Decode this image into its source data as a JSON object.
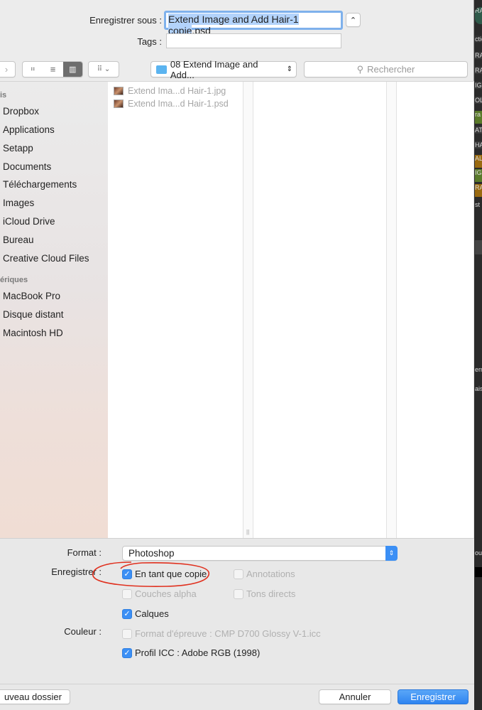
{
  "header": {
    "save_as_label": "Enregistrer sous :",
    "filename": "Extend Image and Add Hair-1 copie",
    "extension": ".psd",
    "tags_label": "Tags :",
    "tags_value": ""
  },
  "toolbar": {
    "location": "08 Extend Image and Add...",
    "search_placeholder": "Rechercher"
  },
  "sidebar": {
    "favorites_header": "is",
    "favorites": [
      "Dropbox",
      "Applications",
      "Setapp",
      "Documents",
      "Téléchargements",
      "Images",
      "iCloud Drive",
      "Bureau",
      "Creative Cloud Files"
    ],
    "devices_header": "ériques",
    "devices": [
      "MacBook Pro",
      "Disque distant",
      "Macintosh HD"
    ]
  },
  "files": [
    "Extend Ima...d Hair-1.jpg",
    "Extend Ima...d Hair-1.psd"
  ],
  "options": {
    "format_label": "Format :",
    "format_value": "Photoshop",
    "save_label": "Enregistrer :",
    "color_label": "Couleur :",
    "checkboxes": [
      {
        "label": "En tant que copie",
        "checked": true,
        "enabled": true
      },
      {
        "label": "Annotations",
        "checked": false,
        "enabled": false
      },
      {
        "label": "Couches alpha",
        "checked": false,
        "enabled": false
      },
      {
        "label": "Tons directs",
        "checked": false,
        "enabled": false
      },
      {
        "label": "Calques",
        "checked": true,
        "enabled": true
      },
      {
        "label": "Format d'épreuve : CMP D700 Glossy V-1.icc",
        "checked": false,
        "enabled": false
      },
      {
        "label": "Profil ICC : Adobe RGB (1998)",
        "checked": true,
        "enabled": true
      }
    ]
  },
  "footer": {
    "new_folder": "uveau dossier",
    "cancel": "Annuler",
    "save": "Enregistrer"
  },
  "colors": {
    "accent": "#3b8ff5",
    "annotation": "#e0301e"
  },
  "background_app_fragments": [
    "RA",
    "ctio",
    "RA",
    "RA",
    "IG",
    "OL",
    "ra",
    "AT",
    "HA",
    "AL",
    "IG",
    "RA",
    "st",
    "ern",
    "ais",
    "oul"
  ]
}
